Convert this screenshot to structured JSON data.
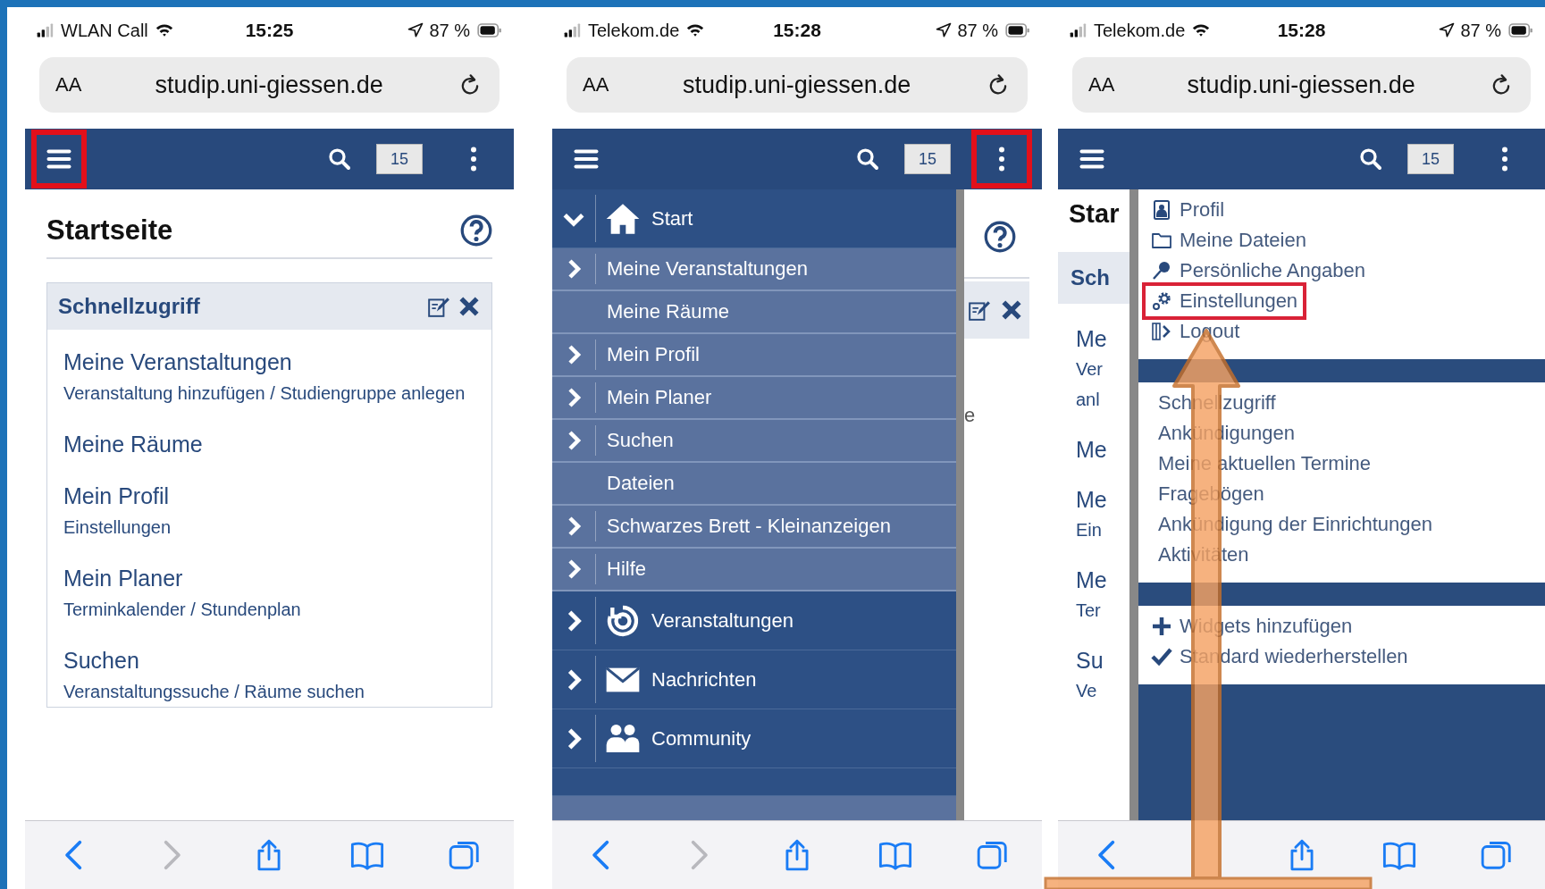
{
  "phones": [
    {
      "kind": "page",
      "status": {
        "carrier": "WLAN Call",
        "time": "15:25",
        "battery": "87 %"
      },
      "url": {
        "text_size": "AA",
        "address": "studip.uni-giessen.de"
      },
      "header": {
        "badge": "15",
        "menu_highlighted": true,
        "more_highlighted": false
      },
      "page": {
        "title": "Startseite",
        "widget": {
          "title": "Schnellzugriff",
          "links": [
            {
              "title": "Meine Veranstaltungen",
              "sub": "Veranstaltung hinzufügen / Studiengruppe anlegen"
            },
            {
              "title": "Meine Räume"
            },
            {
              "title": "Mein Profil",
              "sub": "Einstellungen"
            },
            {
              "title": "Mein Planer",
              "sub": "Terminkalender / Stundenplan"
            },
            {
              "title": "Suchen",
              "sub": "Veranstaltungssuche / Räume suchen"
            }
          ]
        }
      },
      "toolbar": {
        "forward_disabled": true
      }
    },
    {
      "kind": "nav",
      "status": {
        "carrier": "Telekom.de",
        "time": "15:28",
        "battery": "87 %"
      },
      "url": {
        "text_size": "AA",
        "address": "studip.uni-giessen.de"
      },
      "header": {
        "badge": "15",
        "menu_highlighted": false,
        "more_highlighted": true
      },
      "nav": [
        {
          "label": "Start",
          "expanded": true,
          "children": [
            {
              "label": "Meine Veranstaltungen",
              "expandable": true
            },
            {
              "label": "Meine Räume",
              "expandable": false
            },
            {
              "label": "Mein Profil",
              "expandable": true
            },
            {
              "label": "Mein Planer",
              "expandable": true
            },
            {
              "label": "Suchen",
              "expandable": true
            },
            {
              "label": "Dateien",
              "expandable": false
            },
            {
              "label": "Schwarzes Brett - Kleinanzeigen",
              "expandable": true
            },
            {
              "label": "Hilfe",
              "expandable": true
            }
          ]
        },
        {
          "label": "Veranstaltungen",
          "expanded": false
        },
        {
          "label": "Nachrichten",
          "expanded": false
        },
        {
          "label": "Community",
          "expanded": false
        }
      ],
      "behind": {
        "fragment": "e"
      },
      "toolbar": {
        "forward_disabled": true
      }
    },
    {
      "kind": "menu",
      "status": {
        "carrier": "Telekom.de",
        "time": "15:28",
        "battery": "87 %"
      },
      "url": {
        "text_size": "AA",
        "address": "studip.uni-giessen.de"
      },
      "header": {
        "badge": "15",
        "menu_highlighted": false,
        "more_highlighted": false
      },
      "menu": [
        [
          {
            "label": "Profil",
            "highlighted": false
          },
          {
            "label": "Meine Dateien",
            "highlighted": false
          },
          {
            "label": "Persönliche Angaben",
            "highlighted": false
          },
          {
            "label": "Einstellungen",
            "highlighted": true
          },
          {
            "label": "Logout",
            "highlighted": false
          }
        ],
        [
          {
            "label": "Schnellzugriff",
            "highlighted": false
          },
          {
            "label": "Ankündigungen",
            "highlighted": false
          },
          {
            "label": "Meine aktuellen Termine",
            "highlighted": false
          },
          {
            "label": "Fragebögen",
            "highlighted": false
          },
          {
            "label": "Ankündigung der Einrichtungen",
            "highlighted": false
          },
          {
            "label": "Aktivitäten",
            "highlighted": false
          }
        ],
        [
          {
            "label": "Widgets hinzufügen",
            "highlighted": false
          },
          {
            "label": "Standard wiederherstellen",
            "highlighted": false
          }
        ]
      ],
      "behind": {
        "fragments": [
          {
            "text": "Star",
            "kind": "title"
          },
          {
            "text": "Sch",
            "kind": "widget"
          },
          {
            "text": "Me",
            "kind": "link"
          },
          {
            "text": "Ver",
            "kind": "sub"
          },
          {
            "text": "anl",
            "kind": "sub"
          },
          {
            "text": "Me",
            "kind": "link"
          },
          {
            "text": "Me",
            "kind": "link"
          },
          {
            "text": "Ein",
            "kind": "sub"
          },
          {
            "text": "Me",
            "kind": "link"
          },
          {
            "text": "Ter",
            "kind": "sub"
          },
          {
            "text": "Su",
            "kind": "link"
          },
          {
            "text": "Ve",
            "kind": "sub"
          }
        ]
      },
      "arrow": true
    }
  ]
}
